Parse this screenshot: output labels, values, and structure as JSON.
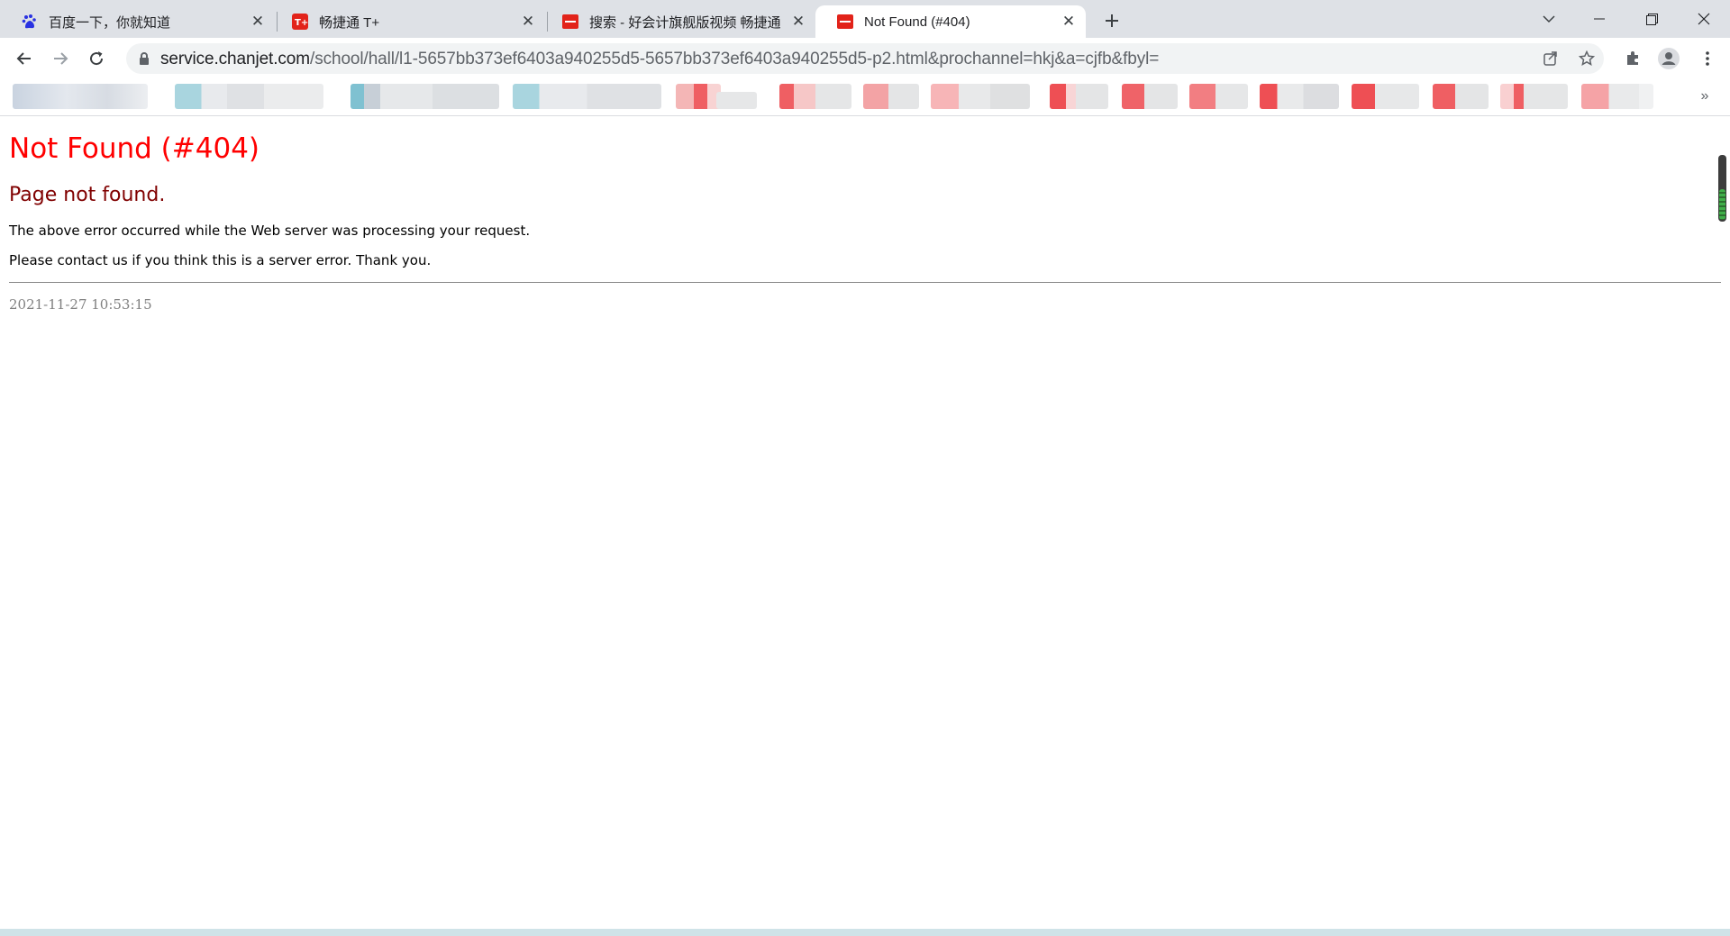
{
  "tabs": [
    {
      "title": "百度一下，你就知道",
      "favicon": "baidu-paw-icon",
      "active": false
    },
    {
      "title": "畅捷通 T+",
      "favicon": "tplus-logo-icon",
      "active": false
    },
    {
      "title": "搜索 - 好会计旗舰版视频 畅捷通",
      "favicon": "chanjet-logo-icon",
      "active": false
    },
    {
      "title": "Not Found (#404)",
      "favicon": "chanjet-logo-icon",
      "active": true
    }
  ],
  "address_bar": {
    "host": "service.chanjet.com",
    "path": "/school/hall/l1-5657bb373ef6403a940255d5-5657bb373ef6403a940255d5-p2.html&prochannel=hkj&a=cjfb&fbyl="
  },
  "page": {
    "title": "Not Found (#404)",
    "subtitle": "Page not found.",
    "line1": "The above error occurred while the Web server was processing your request.",
    "line2": "Please contact us if you think this is a server error. Thank you.",
    "timestamp": "2021-11-27 10:53:15"
  },
  "colors": {
    "error_title": "#ff0000",
    "error_subtitle": "#800000",
    "accent_chanjet": "#e2231a",
    "baidu_blue": "#2932e1"
  }
}
